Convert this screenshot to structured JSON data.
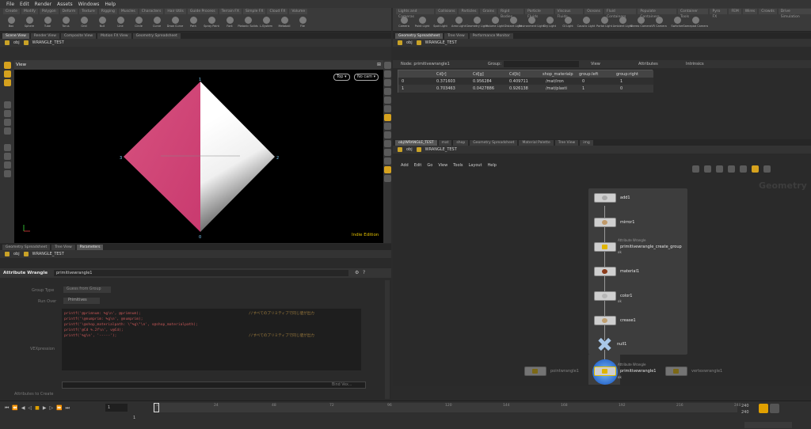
{
  "menu": [
    "File",
    "Edit",
    "Render",
    "Assets",
    "Windows",
    "Help"
  ],
  "shelf_left": {
    "tabs": [
      "Create",
      "Modify",
      "Polygon",
      "Deform",
      "Texture",
      "Rigging",
      "Muscles",
      "Characters",
      "Hair Utils",
      "Guide Process",
      "Terrain FX",
      "Simple FX",
      "Cloud FX",
      "Volume"
    ],
    "tools": [
      "Box",
      "Sphere",
      "Tube",
      "Torus",
      "Grid",
      "Null",
      "Line",
      "Circle",
      "Curve",
      "Draw Curve",
      "Path",
      "Spray Paint",
      "Font",
      "Platonic Solids",
      "L-System",
      "Metaball",
      "File"
    ]
  },
  "shelf_right": {
    "tabs": [
      "Lights and Cameras",
      "Collisions",
      "Particles",
      "Grains",
      "Rigid Bodies",
      "Particle Fluids",
      "Viscous Fluids",
      "Oceans",
      "Fluid Containers",
      "Populate Containers",
      "Container Tools",
      "Pyro FX",
      "FEM",
      "Wires",
      "Crowds",
      "Drive Simulation"
    ],
    "tools": [
      "Camera",
      "Point Light",
      "Spot Light",
      "Area Light",
      "Geometry Light",
      "Volume Light",
      "Distant Light",
      "Environment Light",
      "Sky Light",
      "GI Light",
      "Caustic Light",
      "Portal Light",
      "Ambient Light",
      "Stereo Camera",
      "VR Camera",
      "Switcher",
      "Gamepad Camera"
    ]
  },
  "viewport": {
    "tabs": [
      "Scene View",
      "Render View",
      "Composite View",
      "Motion FX View",
      "Geometry Spreadsheet"
    ],
    "path": [
      "obj",
      "WRANGLE_TEST"
    ],
    "title": "View",
    "view_menu": "Top ▾",
    "cam_menu": "No cam ▾",
    "point_labels": [
      "1",
      "3",
      "2",
      "0"
    ],
    "edition": "Indie Edition"
  },
  "spreadsheet": {
    "tabs": [
      "Geometry Spreadsheet",
      "Tree View",
      "Performance Monitor"
    ],
    "path": [
      "obj",
      "WRANGLE_TEST"
    ],
    "node_label": "Node: primitivewrangle1",
    "group_label": "Group:",
    "view_label": "View",
    "intrinsics": "Intrinsics",
    "attributes": "Attributes",
    "columns": [
      "",
      "Cd[r]",
      "Cd[g]",
      "Cd[b]",
      "shop_materialp",
      "group:left",
      "group:right"
    ],
    "rows": [
      [
        "0",
        "0.371603",
        "0.956284",
        "0.409711",
        "/mat/iron",
        "0",
        "1"
      ],
      [
        "1",
        "0.703463",
        "0.0427886",
        "0.926138",
        "/mat/plasti",
        "1",
        "0"
      ]
    ]
  },
  "params": {
    "tabs": [
      "Geometry Spreadsheet",
      "Tree View",
      "Parameters"
    ],
    "path": [
      "obj",
      "WRANGLE_TEST"
    ],
    "node_type": "Attribute Wrangle",
    "node_name": "primitivewrangle1",
    "group_type_label": "Group Type",
    "group_type_value": "Guess from Group",
    "run_over_label": "Run Over",
    "run_over_value": "Primitives",
    "vexpression_label": "VEXpression",
    "code_lines": [
      "printf('@primnum: %g\\n', @primnum);",
      "printf('\\@numprim: %g\\n', @numprim);",
      "printf('\\@shop_materialpath: \\\"%g\\\"\\n', s@shop_materialpath);",
      "printf('@Cd %.2f\\n', v@Cd);",
      "printf('%g\\n', '-----');"
    ],
    "comment_1": "//すべてのプリミティブで同じ値が出力",
    "comment_2": "//すべてのプリミティブで同じ値が出力",
    "attr_to_create_label": "Attributes to Create",
    "bind_button": "Bind Vex..."
  },
  "network": {
    "tabs": [
      "obj/WRANGLE_TEST",
      "mat",
      "shop",
      "Geometry Spreadsheet",
      "Material Palette",
      "Tree View",
      "img"
    ],
    "path": [
      "obj",
      "WRANGLE_TEST"
    ],
    "menu": [
      "Add",
      "Edit",
      "Go",
      "View",
      "Tools",
      "Layout",
      "Help"
    ],
    "context_label": "Geometry",
    "nodes": [
      {
        "name": "add1",
        "type": "",
        "flag": ""
      },
      {
        "name": "mirror1",
        "type": "",
        "flag": ""
      },
      {
        "name": "primitivewrangle_create_group",
        "type": "Attribute Wrangle",
        "flag": "ok"
      },
      {
        "name": "material1",
        "type": "",
        "flag": ""
      },
      {
        "name": "color1",
        "type": "",
        "flag": "ok"
      },
      {
        "name": "crease1",
        "type": "",
        "flag": ""
      },
      {
        "name": "null1",
        "type": "",
        "flag": ""
      },
      {
        "name": "primitivewrangle1",
        "type": "Attribute Wrangle",
        "flag": "ok"
      }
    ],
    "ghost_nodes": [
      "pointwrangle1",
      "vertexwrangle1"
    ]
  },
  "timeline": {
    "ticks": [
      "1",
      "24",
      "48",
      "72",
      "96",
      "120",
      "144",
      "168",
      "192",
      "216",
      "240"
    ],
    "frame": "1",
    "start": "1",
    "end": "240",
    "end2": "240"
  },
  "colors": {
    "pink": "#d23c7a",
    "accent": "#d6a21e",
    "bg": "#2b2b2b"
  }
}
